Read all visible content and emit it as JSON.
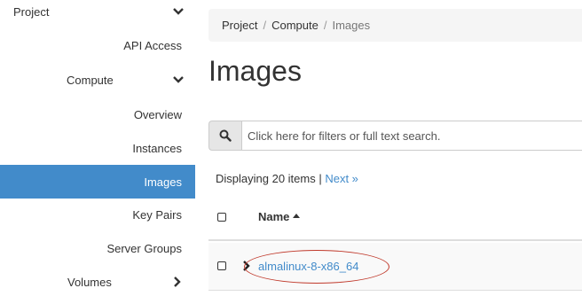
{
  "sidebar": {
    "items": [
      {
        "label": "Project",
        "chevron": "down"
      },
      {
        "label": "API Access"
      },
      {
        "label": "Compute",
        "chevron": "down"
      },
      {
        "label": "Overview"
      },
      {
        "label": "Instances"
      },
      {
        "label": "Images",
        "active": true
      },
      {
        "label": "Key Pairs"
      },
      {
        "label": "Server Groups"
      },
      {
        "label": "Volumes",
        "chevron": "right"
      }
    ]
  },
  "breadcrumb": {
    "items": [
      "Project",
      "Compute",
      "Images"
    ],
    "separator": "/"
  },
  "page": {
    "title": "Images"
  },
  "search": {
    "icon": "search-icon",
    "placeholder": "Click here for filters or full text search."
  },
  "table": {
    "count_text": "Displaying 20 items |",
    "next_label": "Next »",
    "columns": {
      "name": "Name"
    },
    "sort": "ascending",
    "rows": [
      {
        "name": "almalinux-8-x86_64",
        "highlighted": true
      }
    ]
  },
  "colors": {
    "accent": "#428bca",
    "active_bg": "#428bca",
    "highlight": "#c0392b",
    "breadcrumb_bg": "#f5f5f5"
  }
}
